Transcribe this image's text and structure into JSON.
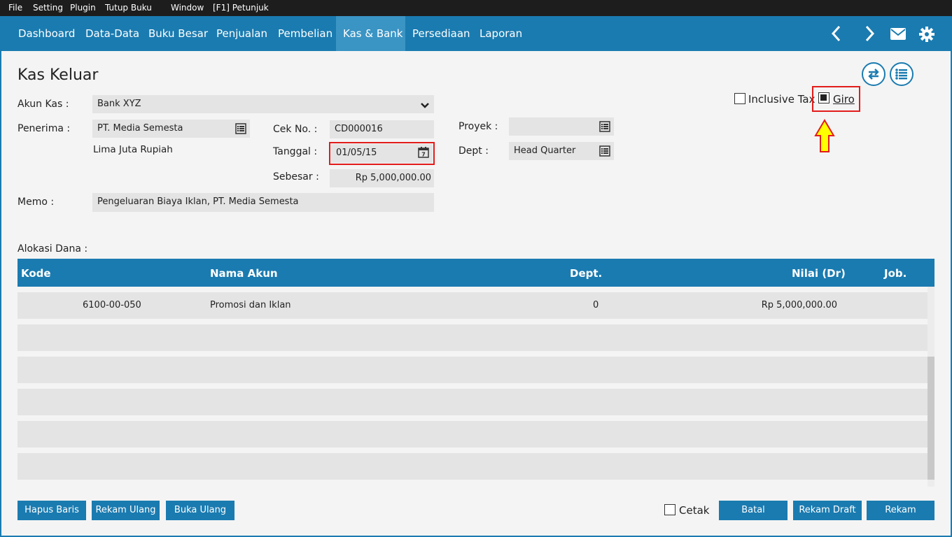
{
  "menubar": {
    "items": [
      "File",
      "Setting",
      "Plugin",
      "Tutup Buku",
      "Window",
      "[F1] Petunjuk"
    ]
  },
  "navbar": {
    "items": [
      "Dashboard",
      "Data-Data",
      "Buku Besar",
      "Penjualan",
      "Pembelian",
      "Kas & Bank",
      "Persediaan",
      "Laporan"
    ],
    "active": "Kas & Bank",
    "icons": [
      "chevron-left-icon",
      "chevron-right-icon",
      "envelope-icon",
      "gear-icon"
    ]
  },
  "form": {
    "title": "Kas Keluar",
    "akun_kas_label": "Akun Kas :",
    "akun_kas_value": "Bank XYZ",
    "penerima_label": "Penerima :",
    "penerima_value": "PT. Media Semesta",
    "terbilang": "Lima Juta Rupiah",
    "cek_no_label": "Cek No. :",
    "cek_no_value": "CD000016",
    "tanggal_label": "Tanggal :",
    "tanggal_value": "01/05/15",
    "sebesar_label": "Sebesar :",
    "sebesar_value": "Rp 5,000,000.00",
    "proyek_label": "Proyek :",
    "proyek_value": "",
    "dept_label": "Dept :",
    "dept_value": "Head Quarter",
    "memo_label": "Memo :",
    "memo_value": "Pengeluaran Biaya Iklan, PT. Media Semesta",
    "inclusive_tax_label": "Inclusive Tax",
    "inclusive_tax_checked": false,
    "giro_label": "Giro",
    "giro_checked": true
  },
  "grid": {
    "section_label": "Alokasi Dana :",
    "columns": [
      "Kode",
      "Nama Akun",
      "Dept.",
      "Nilai (Dr)",
      "Job."
    ],
    "rows": [
      {
        "kode": "6100-00-050",
        "nama_akun": "Promosi dan Iklan",
        "dept": "0",
        "nilai": "Rp 5,000,000.00",
        "job": ""
      },
      {
        "kode": "",
        "nama_akun": "",
        "dept": "",
        "nilai": "",
        "job": ""
      },
      {
        "kode": "",
        "nama_akun": "",
        "dept": "",
        "nilai": "",
        "job": ""
      },
      {
        "kode": "",
        "nama_akun": "",
        "dept": "",
        "nilai": "",
        "job": ""
      },
      {
        "kode": "",
        "nama_akun": "",
        "dept": "",
        "nilai": "",
        "job": ""
      },
      {
        "kode": "",
        "nama_akun": "",
        "dept": "",
        "nilai": "",
        "job": ""
      }
    ]
  },
  "footer": {
    "hapus_baris": "Hapus Baris",
    "rekam_ulang": "Rekam Ulang",
    "buka_ulang": "Buka Ulang",
    "cetak_label": "Cetak",
    "cetak_checked": false,
    "batal": "Batal",
    "rekam_draft": "Rekam Draft",
    "rekam": "Rekam"
  },
  "colors": {
    "accent": "#1a7bb0",
    "highlight": "#e31b1b",
    "arrow": "#ffff00"
  }
}
